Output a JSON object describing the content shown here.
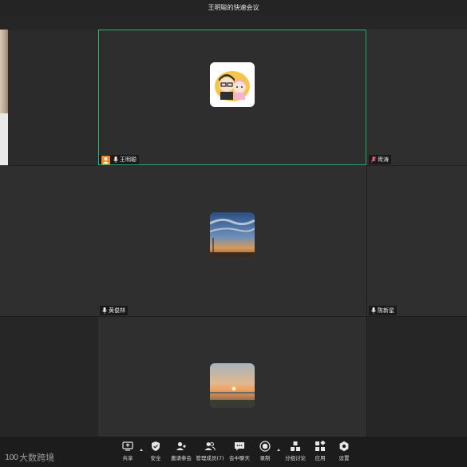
{
  "window": {
    "title": "王明聪的快速会议"
  },
  "participants": [
    {
      "name": "王明聪",
      "muted": false,
      "host": true
    },
    {
      "name": "胥涛",
      "muted": true
    },
    {
      "name": "黄俊林",
      "muted": false
    },
    {
      "name": "陈新星",
      "muted": false
    }
  ],
  "toolbar": {
    "share": "共享",
    "security": "安全",
    "invite": "邀请参会",
    "manage": "管理成员(7)",
    "chat": "会中聊天",
    "record": "录制",
    "breakout": "分组讨论",
    "apps": "应用",
    "settings": "设置"
  },
  "logo": {
    "text": "大数跨境",
    "mark": "100"
  },
  "colors": {
    "active_speaker_border": "#2bb673",
    "host_badge": "#f08a24",
    "muted_mic": "#e0607a"
  }
}
